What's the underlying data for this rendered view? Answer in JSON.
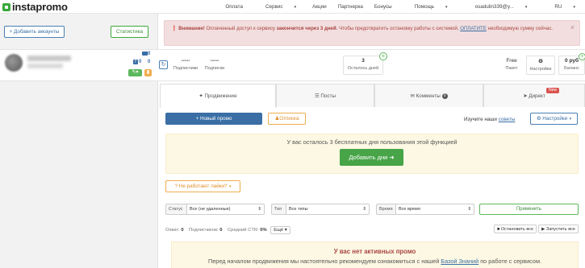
{
  "brand": {
    "name": "instapromo",
    "color": "#3aa93a"
  },
  "nav": {
    "items": [
      "Оплата",
      "Сервис",
      "Акции",
      "Партнерка",
      "Бонусы",
      "Помощь"
    ],
    "user": "osadulin339@y...",
    "lang": "RU"
  },
  "sidebar": {
    "add_accounts": "+ Добавить аккаунты",
    "statistics": "Статистика"
  },
  "alert": {
    "strong": "Внимание!",
    "text1": " Оплаченный доступ к сервису ",
    "strong2": "закончится через 3 дней",
    "text2": ". Чтобы предотвратить остановку работы с системой, ",
    "link": "ОПЛАТИТЕ",
    "text3": " необходимую сумму сейчас.",
    "close": "×"
  },
  "account": {
    "counters": {
      "messages": "0",
      "fb": "0",
      "other": "0"
    },
    "followers": {
      "value": "-----",
      "label": "Подписчики"
    },
    "following": {
      "value": "-----",
      "label": "Подписки"
    },
    "days": {
      "value": "3",
      "label": "Осталось дней"
    },
    "package": {
      "value": "Free",
      "label": "Пакет"
    },
    "settings": {
      "icon": "⚙",
      "label": "Настройки"
    },
    "balance": {
      "value": "0 руб",
      "label": "Баланс"
    }
  },
  "tabs": {
    "promo": "Продвижение",
    "posts": "Посты",
    "comments": "Комменты",
    "comments_count": "0",
    "direct": "Директ",
    "direct_badge": "New"
  },
  "toolbar": {
    "new_promo": "+ Новый промо",
    "unsubscribe": "Отписка",
    "learn_prefix": "Изучите наши ",
    "learn_link": "советы",
    "settings": "Настройки"
  },
  "trial": {
    "text": "У вас осталось 3 бесплатных дня пользования этой функцией",
    "button": "Добавить дни ➜"
  },
  "likes_issue": "Не работают лайки?",
  "filters": {
    "status_label": "Статус",
    "status_value": "Все (не удаленные)",
    "type_label": "Тип",
    "type_value": "Все типы",
    "time_label": "Время",
    "time_value": "Все время",
    "apply": "Применить"
  },
  "stats": {
    "reach_label": "Охват: ",
    "reach": "0",
    "subs_label": "Подписчиков: ",
    "subs": "0",
    "ctr_label": "Средний CTR: ",
    "ctr": "0%",
    "more": "Ещё",
    "stop_all": "Остановить все",
    "start_all": "Запустить все"
  },
  "no_promo": {
    "title": "У вас нет активных промо",
    "text1": "Перед началом продвижения мы настоятельно рекомендуем ознакомиться с нашей ",
    "link": "Базой Знаний",
    "text2": " по работе с сервисом."
  }
}
